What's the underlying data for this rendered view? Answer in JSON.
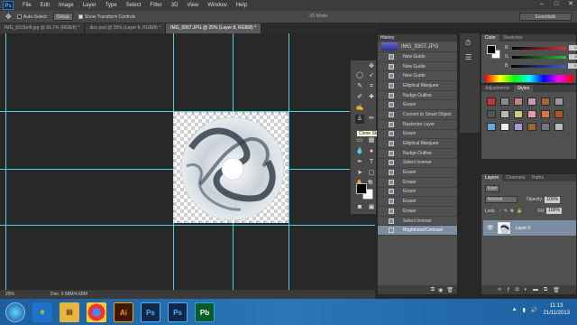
{
  "app": {
    "logo": "Ps",
    "menus": [
      "File",
      "Edit",
      "Image",
      "Layer",
      "Type",
      "Select",
      "Filter",
      "3D",
      "View",
      "Window",
      "Help"
    ]
  },
  "window_controls": {
    "minimize": "–",
    "maximize": "□",
    "close": "✕"
  },
  "options_bar": {
    "auto_select": "Auto-Select:",
    "auto_select_value": "Group",
    "show_transform": "Show Transform Controls",
    "mode3d": "3D Mode:",
    "workspace": "Essentials"
  },
  "tabs": [
    {
      "label": "IMG_9315e4f.jpg @ 66.7% (RGB/8) *",
      "active": false
    },
    {
      "label": "disc.psd @ 25% (Layer 8, RGB/8) *",
      "active": false
    },
    {
      "label": "IMG_9307.JPG @ 25% (Layer 8, RGB/8) *",
      "active": true
    }
  ],
  "status": {
    "zoom": "25%",
    "doc": "Doc: 3.68M/4.69M"
  },
  "tooltip": "Clone Stamp Tool (S)",
  "history": {
    "title": "History",
    "snapshot": "IMG_9307.JPG",
    "items": [
      "New Guide",
      "New Guide",
      "New Guide",
      "Elliptical Marquee",
      "Nudge Outline",
      "Eraser",
      "Convert to Smart Object",
      "Rasterize Layer",
      "Eraser",
      "Elliptical Marquee",
      "Nudge Outline",
      "Select Inverse",
      "Eraser",
      "Eraser",
      "Eraser",
      "Eraser",
      "Eraser",
      "Select Inverse",
      "Brightness/Contrast"
    ],
    "selected_index": 18
  },
  "color_panel": {
    "tabs": [
      "Color",
      "Swatches"
    ],
    "channels": [
      {
        "label": "R",
        "value": "0",
        "color": "#e03030"
      },
      {
        "label": "G",
        "value": "0",
        "color": "#30c030"
      },
      {
        "label": "B",
        "value": "0",
        "color": "#3060e0"
      }
    ]
  },
  "styles_panel": {
    "tabs": [
      "Adjustments",
      "Styles"
    ]
  },
  "layers_panel": {
    "tabs": [
      "Layers",
      "Channels",
      "Paths"
    ],
    "kind": "Kind",
    "blend_mode": "Normal",
    "opacity_label": "Opacity:",
    "opacity": "100%",
    "lock_label": "Lock:",
    "fill_label": "Fill:",
    "fill": "100%",
    "layer_name": "Layer 0"
  },
  "taskbar": {
    "time": "11:13",
    "date": "21/11/2013",
    "apps": [
      "Ie",
      "Files",
      "Chrome",
      "Ai",
      "Ps",
      "Ps",
      "Pb"
    ]
  },
  "colors": {
    "accent": "#7b8ea2",
    "guide": "#4fd3e0",
    "taskbar": "#2a76b6"
  }
}
